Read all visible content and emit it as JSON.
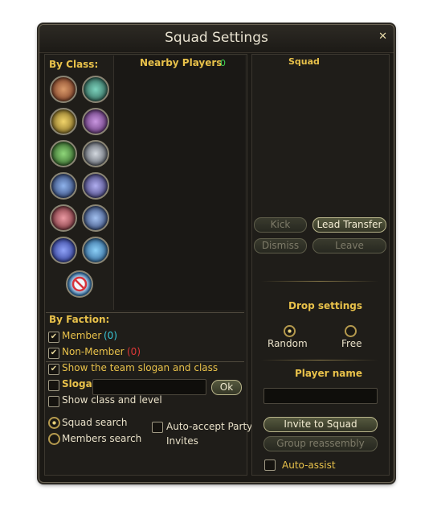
{
  "window": {
    "title": "Squad Settings"
  },
  "left": {
    "by_class_label": "By Class:",
    "classes": [
      {
        "icon": "warrior-class-icon",
        "color": "#b9653b"
      },
      {
        "icon": "mystic-class-icon",
        "color": "#3f8f7b"
      },
      {
        "icon": "assassin-class-icon",
        "color": "#c6a431"
      },
      {
        "icon": "sorcerer-class-icon",
        "color": "#8b4fa2"
      },
      {
        "icon": "ranger-class-icon",
        "color": "#4a8f3c"
      },
      {
        "icon": "spiritmaster-class-icon",
        "color": "#8c93a0"
      },
      {
        "icon": "gunner-class-icon",
        "color": "#3b5fa6"
      },
      {
        "icon": "songweaver-class-icon",
        "color": "#5c58a8"
      },
      {
        "icon": "cleric-class-icon",
        "color": "#a23b44"
      },
      {
        "icon": "chanter-class-icon",
        "color": "#4468a6"
      },
      {
        "icon": "aethertech-class-icon",
        "color": "#3a57b6"
      },
      {
        "icon": "painter-class-icon",
        "color": "#2f7bbf"
      },
      {
        "icon": "no-class-icon",
        "color": "#2f7bbf"
      }
    ],
    "nearby_label": "Nearby Players",
    "nearby_count": "0",
    "by_faction_label": "By Faction:",
    "member_label": "Member",
    "member_count": "(0)",
    "nonmember_label": "Non-Member",
    "nonmember_count": "(0)",
    "show_slogan_label": "Show the team slogan and class",
    "slogan_label": "Slogan",
    "ok_label": "Ok",
    "show_class_label": "Show class and level",
    "squad_search_label": "Squad search",
    "members_search_label": "Members search",
    "auto_accept_label_1": "Auto-accept Party",
    "auto_accept_label_2": "Invites"
  },
  "right": {
    "squad_label": "Squad",
    "kick_label": "Kick",
    "lead_transfer_label": "Lead Transfer",
    "dismiss_label": "Dismiss",
    "leave_label": "Leave",
    "drop_settings_label": "Drop settings",
    "random_label": "Random",
    "free_label": "Free",
    "player_name_label": "Player name",
    "invite_label": "Invite to Squad",
    "group_reassembly_label": "Group reassembly",
    "auto_assist_label": "Auto-assist"
  }
}
